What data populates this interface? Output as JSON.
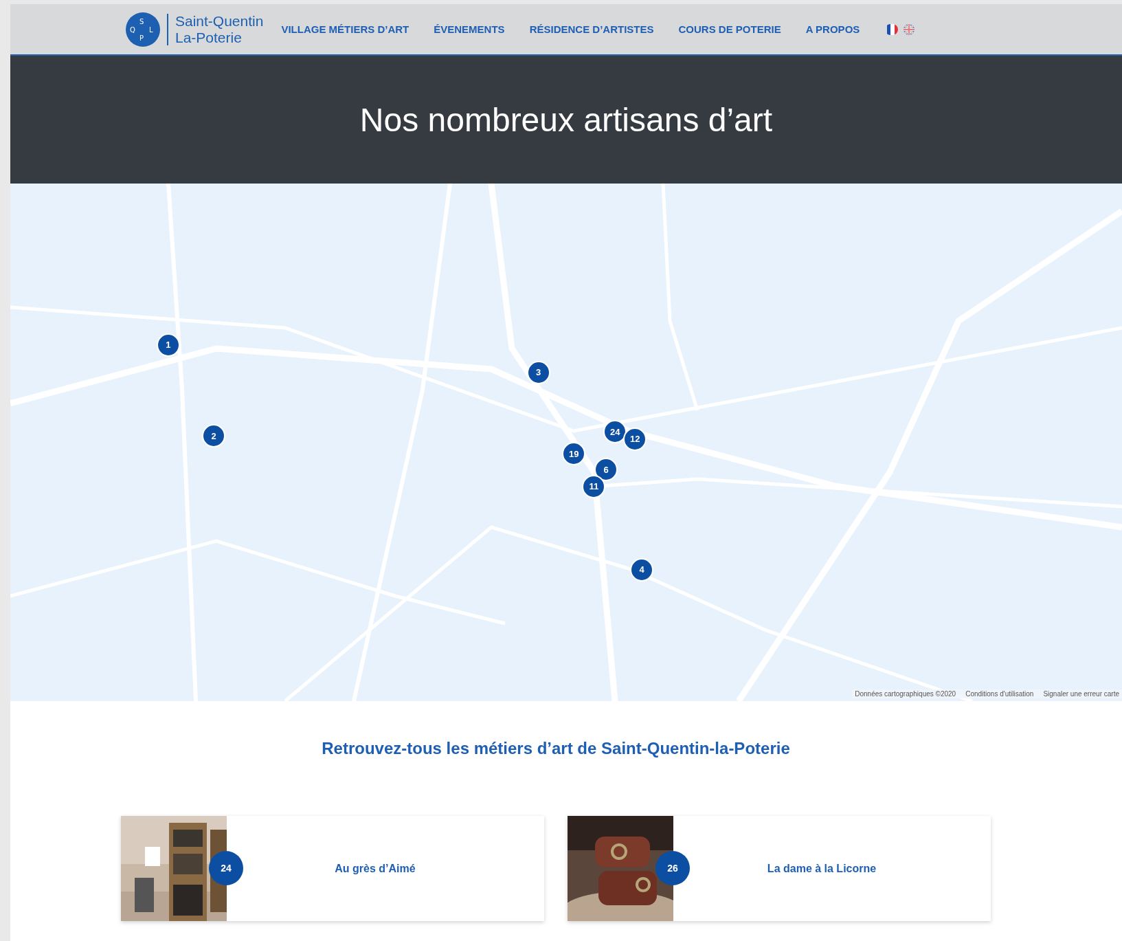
{
  "logo": {
    "letters": [
      "S",
      "Q",
      "L",
      "P"
    ],
    "line_1": "Saint-Quentin",
    "line_2": "La-Poterie"
  },
  "nav": [
    {
      "label": "VILLAGE MÉTIERS D’ART"
    },
    {
      "label": "ÉVENEMENTS"
    },
    {
      "label": "RÉSIDENCE D’ARTISTES"
    },
    {
      "label": "COURS DE POTERIE"
    },
    {
      "label": "A PROPOS"
    }
  ],
  "languages": [
    {
      "kind": "fr",
      "selected": true
    },
    {
      "kind": "en",
      "selected": false
    }
  ],
  "hero": {
    "title": "Nos nombreux artisans d’art"
  },
  "map": {
    "markers": [
      {
        "label": "1"
      },
      {
        "label": "2"
      },
      {
        "label": "3"
      },
      {
        "label": "4"
      },
      {
        "label": "19"
      },
      {
        "label": "24"
      },
      {
        "label": "12"
      },
      {
        "label": "6"
      },
      {
        "label": "11"
      }
    ],
    "footer": [
      "Données cartographiques ©2020",
      "Conditions d'utilisation",
      "Signaler une erreur carte"
    ]
  },
  "section": {
    "title": "Retrouvez-tous les métiers d’art de Saint-Quentin-la-Poterie"
  },
  "cards": [
    {
      "number": "24",
      "title": "Au grès d’Aimé"
    },
    {
      "number": "26",
      "title": "La dame à la Licorne"
    }
  ]
}
